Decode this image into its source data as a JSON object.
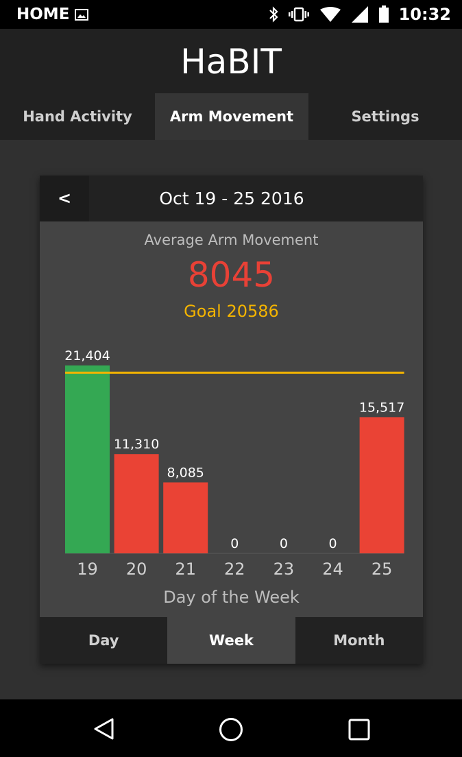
{
  "status_bar": {
    "carrier": "HOME",
    "time": "10:32",
    "icons": [
      "image-icon",
      "bluetooth-icon",
      "vibrate-icon",
      "wifi-icon",
      "signal-icon",
      "battery-icon"
    ]
  },
  "app": {
    "title": "HaBIT"
  },
  "tabs": [
    {
      "label": "Hand Activity",
      "active": false
    },
    {
      "label": "Arm Movement",
      "active": true
    },
    {
      "label": "Settings",
      "active": false
    }
  ],
  "card": {
    "prev_label": "<",
    "date_range": "Oct 19 - 25 2016",
    "summary_label": "Average Arm Movement",
    "summary_value": "8045",
    "goal_text": "Goal 20586"
  },
  "chart_data": {
    "type": "bar",
    "categories": [
      "19",
      "20",
      "21",
      "22",
      "23",
      "24",
      "25"
    ],
    "values": [
      21404,
      11310,
      8085,
      0,
      0,
      0,
      15517
    ],
    "value_labels": [
      "21,404",
      "11,310",
      "8,085",
      "0",
      "0",
      "0",
      "15,517"
    ],
    "bar_colors": [
      "#34a853",
      "#ea4335",
      "#ea4335",
      "#ea4335",
      "#ea4335",
      "#ea4335",
      "#ea4335"
    ],
    "goal": 20586,
    "goal_color": "#f4b400",
    "xlabel": "Day of the Week",
    "ylabel": "",
    "ylim": [
      0,
      21404
    ]
  },
  "range_tabs": [
    {
      "label": "Day",
      "active": false
    },
    {
      "label": "Week",
      "active": true
    },
    {
      "label": "Month",
      "active": false
    }
  ],
  "nav": {
    "icons": [
      "back-icon",
      "home-icon",
      "recents-icon"
    ]
  },
  "colors": {
    "header_bg": "#212121",
    "content_bg": "#303030",
    "card_bg": "#444444",
    "summary_value": "#e84136",
    "goal": "#f4b400"
  }
}
